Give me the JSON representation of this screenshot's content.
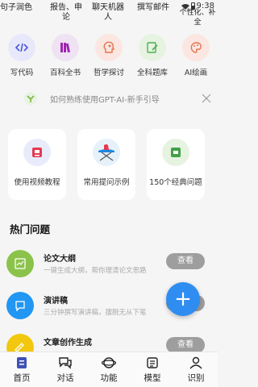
{
  "top_tabs": [
    {
      "label": "句子润色"
    },
    {
      "label": "报告、申\n论"
    },
    {
      "label": "聊天机器\n人"
    },
    {
      "label": "撰写邮件"
    },
    {
      "label": "个性化、补全"
    }
  ],
  "status_bar": {
    "time": "9:38"
  },
  "categories": [
    {
      "label": "写代码",
      "icon": "code-icon",
      "color": "#e8e8fb"
    },
    {
      "label": "百科全书",
      "icon": "books-icon",
      "color": "#efe3f3"
    },
    {
      "label": "哲学探讨",
      "icon": "head-icon",
      "color": "#fbe6e1"
    },
    {
      "label": "全科题库",
      "icon": "edit-icon",
      "color": "#e6f3e1"
    },
    {
      "label": "AI绘画",
      "icon": "palette-icon",
      "color": "#fbe6e1"
    }
  ],
  "tip": {
    "text": "如何熟练使用GPT-AI-新手引导"
  },
  "cards": [
    {
      "label": "使用视频教程",
      "icon": "video-icon"
    },
    {
      "label": "常用提问示例",
      "icon": "ironing-icon"
    },
    {
      "label": "150个经典问题",
      "icon": "chat-icon"
    }
  ],
  "hot": {
    "title": "热门问题",
    "items": [
      {
        "title": "论文大纲",
        "subtitle": "一键生成大纲，帮你理清论文思路",
        "button": "查看",
        "color": "#8bc34a"
      },
      {
        "title": "演讲稿",
        "subtitle": "三分钟撰写演讲稿，摆脱无从下笔",
        "button": "查看",
        "color": "#2196f3"
      },
      {
        "title": "文章创作生成",
        "subtitle": "",
        "button": "查看",
        "color": "#f2c80f"
      }
    ]
  },
  "fab": {
    "label": "+"
  },
  "tabbar": [
    {
      "label": "首页",
      "icon": "home-icon",
      "active": true
    },
    {
      "label": "对话",
      "icon": "chat-bubbles-icon"
    },
    {
      "label": "功能",
      "icon": "function-icon"
    },
    {
      "label": "模型",
      "icon": "model-icon"
    },
    {
      "label": "识别",
      "icon": "user-icon"
    }
  ]
}
